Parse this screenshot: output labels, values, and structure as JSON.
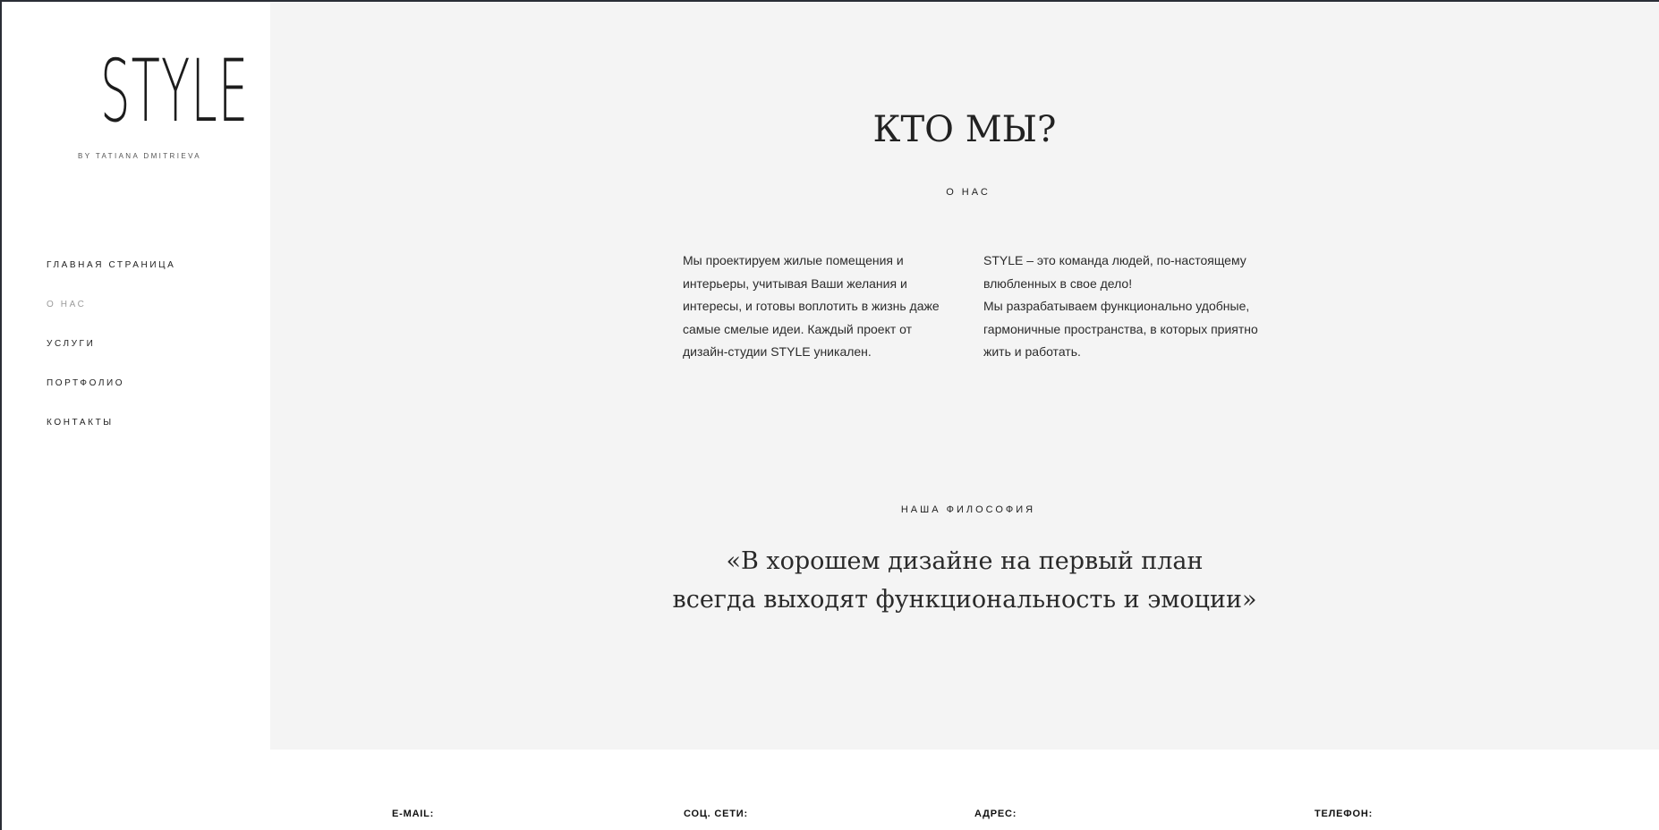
{
  "logo": {
    "wordmark": "STYLE",
    "tagline": "BY TATIANA DMITRIEVA"
  },
  "nav": {
    "items": [
      {
        "label": "ГЛАВНАЯ СТРАНИЦА",
        "active": false
      },
      {
        "label": "О НАС",
        "active": true
      },
      {
        "label": "УСЛУГИ",
        "active": false
      },
      {
        "label": "ПОРТФОЛИО",
        "active": false
      },
      {
        "label": "КОНТАКТЫ",
        "active": false
      }
    ]
  },
  "about": {
    "title": "КТО МЫ?",
    "subtitle": "О НАС",
    "text_left": "Мы проектируем жилые помещения и интерьеры, учитывая Ваши желания и интересы, и готовы воплотить в жизнь даже самые смелые идеи. Каждый проект от дизайн-студии STYLE уникален.",
    "text_right_1": "STYLE – это команда людей, по-настоящему влюбленных в свое дело!",
    "text_right_2": "Мы разрабатываем функционально удобные, гармоничные пространства, в которых приятно жить и работать."
  },
  "philosophy": {
    "label": "НАША ФИЛОСОФИЯ",
    "quote_line1": "«В хорошем дизайне на первый план",
    "quote_line2": "всегда выходят функциональность и эмоции»"
  },
  "footer": {
    "email_label": "E-MAIL:",
    "social_label": "СОЦ. СЕТИ:",
    "address_label": "АДРЕС:",
    "phone_label": "ТЕЛЕФОН:"
  },
  "colors": {
    "main_bg": "#f4f4f4",
    "sidebar_bg": "#ffffff",
    "active_nav": "#9a9a9a",
    "frame": "#2a2e36"
  }
}
